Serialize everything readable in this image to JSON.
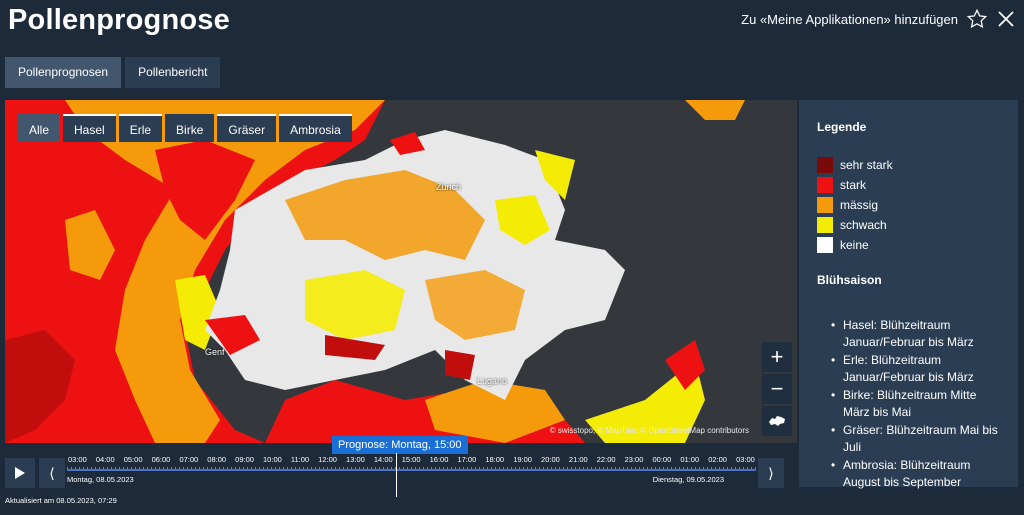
{
  "header": {
    "title": "Pollenprognose",
    "add_link": "Zu «Meine Applikationen» hinzufügen"
  },
  "top_tabs": [
    {
      "label": "Pollenprognosen",
      "active": true
    },
    {
      "label": "Pollenbericht",
      "active": false
    }
  ],
  "filter_tabs": [
    {
      "label": "Alle",
      "active": true
    },
    {
      "label": "Hasel",
      "active": false
    },
    {
      "label": "Erle",
      "active": false
    },
    {
      "label": "Birke",
      "active": false
    },
    {
      "label": "Gräser",
      "active": false
    },
    {
      "label": "Ambrosia",
      "active": false
    }
  ],
  "map": {
    "cities": [
      "Zürich",
      "Genf",
      "Lugano"
    ],
    "attribution": "© swisstopo, © MapTiler, © OpenStreetMap contributors",
    "zoom_in": "+",
    "zoom_out": "−"
  },
  "legend": {
    "title": "Legende",
    "levels": [
      {
        "label": "sehr stark",
        "color": "#7a0a0a"
      },
      {
        "label": "stark",
        "color": "#ee1111"
      },
      {
        "label": "mässig",
        "color": "#f59a0a"
      },
      {
        "label": "schwach",
        "color": "#f5ec05"
      },
      {
        "label": "keine",
        "color": "#ffffff"
      }
    ],
    "season_title": "Blühsaison",
    "seasons": [
      "Hasel: Blühzeitraum Januar/Februar bis März",
      "Erle: Blühzeitraum Januar/Februar bis März",
      "Birke: Blühzeitraum Mitte März bis Mai",
      "Gräser: Blühzeitraum Mai bis Juli",
      "Ambrosia: Blühzeitraum August bis September"
    ]
  },
  "timeline": {
    "forecast_label": "Prognose: Montag, 15:00",
    "hours": [
      "03:00",
      "04:00",
      "05:00",
      "06:00",
      "07:00",
      "08:00",
      "09:00",
      "10:00",
      "11:00",
      "12:00",
      "13:00",
      "14:00",
      "15:00",
      "16:00",
      "17:00",
      "18:00",
      "19:00",
      "20:00",
      "21:00",
      "22:00",
      "23:00",
      "00:00",
      "01:00",
      "02:00",
      "03:00"
    ],
    "date_left": "Montag, 08.05.2023",
    "date_right": "Dienstag, 09.05.2023"
  },
  "updated": "Aktualisiert am 08.05.2023, 07:29"
}
